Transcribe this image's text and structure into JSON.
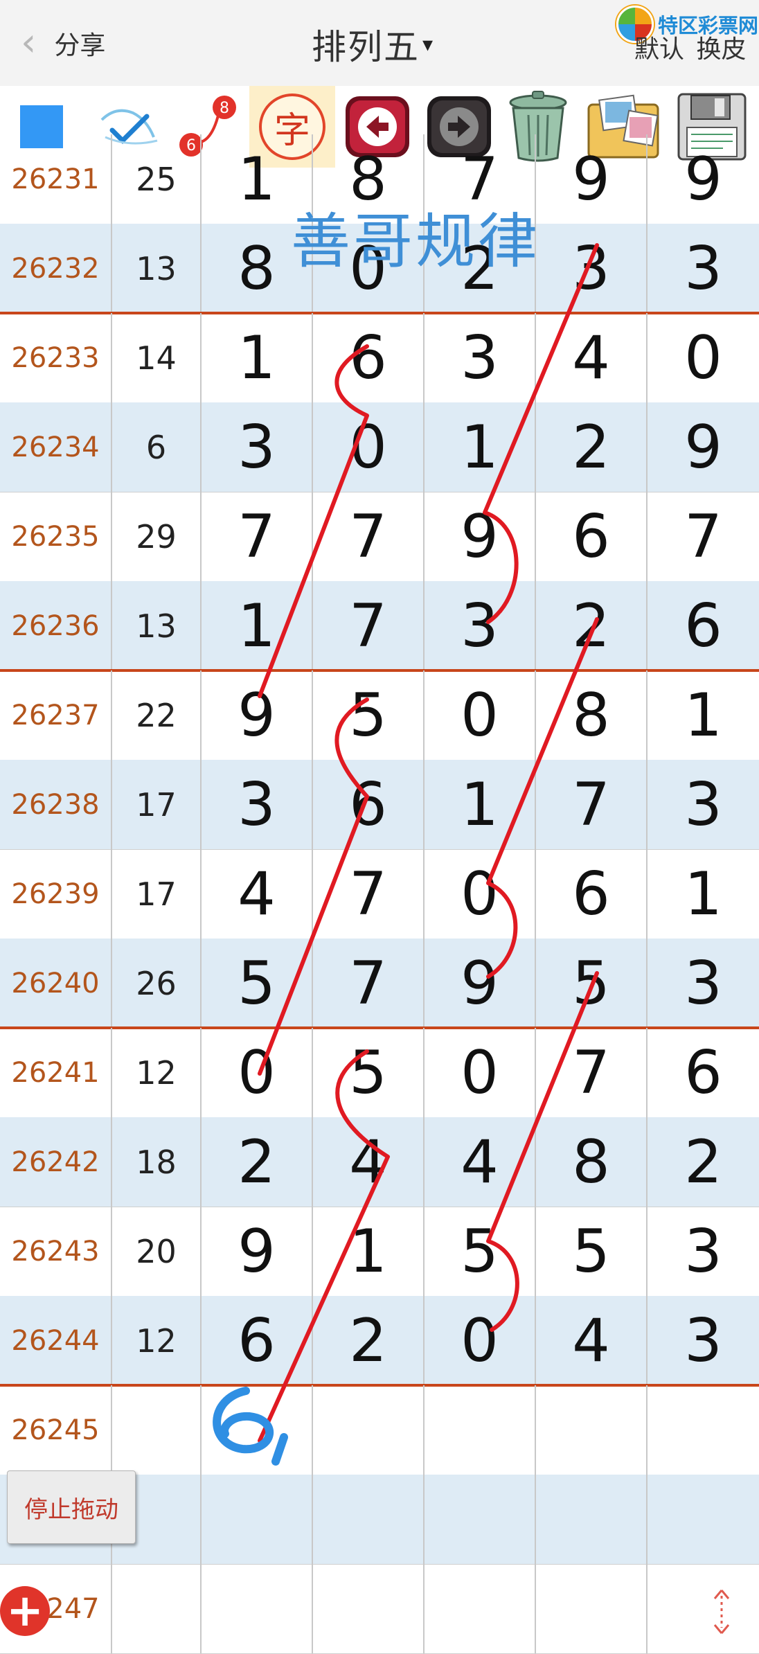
{
  "header": {
    "back_label": "分享",
    "title": "排列五",
    "title_caret": "▾",
    "logo_text": "特区彩票网",
    "default_label": "默认",
    "skin_label": "换皮"
  },
  "toolbar": {
    "icons": [
      "color-square-icon",
      "pen-check-icon",
      "circle-number-icon",
      "text-char-icon",
      "undo-arrow-icon",
      "redo-arrow-icon",
      "trash-can-icon",
      "photo-album-icon",
      "floppy-disk-icon"
    ],
    "circle_badge_top": "8",
    "circle_badge_bottom": "6",
    "text_char": "字",
    "square_color": "#3398f5"
  },
  "overlay": {
    "rule_title": "善哥规律",
    "handwritten_digit": "6",
    "ink_red": "#e01a22",
    "ink_blue": "#2f8fe3"
  },
  "rows": [
    {
      "issue": "26231",
      "sum": "25",
      "d": [
        "1",
        "8",
        "7",
        "9",
        "9"
      ]
    },
    {
      "issue": "26232",
      "sum": "13",
      "d": [
        "8",
        "0",
        "2",
        "3",
        "3"
      ]
    },
    {
      "issue": "26233",
      "sum": "14",
      "d": [
        "1",
        "6",
        "3",
        "4",
        "0"
      ]
    },
    {
      "issue": "26234",
      "sum": "6",
      "d": [
        "3",
        "0",
        "1",
        "2",
        "9"
      ]
    },
    {
      "issue": "26235",
      "sum": "29",
      "d": [
        "7",
        "7",
        "9",
        "6",
        "7"
      ]
    },
    {
      "issue": "26236",
      "sum": "13",
      "d": [
        "1",
        "7",
        "3",
        "2",
        "6"
      ]
    },
    {
      "issue": "26237",
      "sum": "22",
      "d": [
        "9",
        "5",
        "0",
        "8",
        "1"
      ]
    },
    {
      "issue": "26238",
      "sum": "17",
      "d": [
        "3",
        "6",
        "1",
        "7",
        "3"
      ]
    },
    {
      "issue": "26239",
      "sum": "17",
      "d": [
        "4",
        "7",
        "0",
        "6",
        "1"
      ]
    },
    {
      "issue": "26240",
      "sum": "26",
      "d": [
        "5",
        "7",
        "9",
        "5",
        "3"
      ]
    },
    {
      "issue": "26241",
      "sum": "12",
      "d": [
        "0",
        "5",
        "0",
        "7",
        "6"
      ]
    },
    {
      "issue": "26242",
      "sum": "18",
      "d": [
        "2",
        "4",
        "4",
        "8",
        "2"
      ]
    },
    {
      "issue": "26243",
      "sum": "20",
      "d": [
        "9",
        "1",
        "5",
        "5",
        "3"
      ]
    },
    {
      "issue": "26244",
      "sum": "12",
      "d": [
        "6",
        "2",
        "0",
        "4",
        "3"
      ]
    },
    {
      "issue": "26245",
      "sum": "",
      "d": [
        "",
        "",
        "",
        "",
        ""
      ]
    },
    {
      "issue": "",
      "sum": "",
      "d": [
        "",
        "",
        "",
        "",
        ""
      ]
    },
    {
      "issue": "26247",
      "sum": "",
      "d": [
        "",
        "",
        "",
        "",
        ""
      ]
    }
  ],
  "controls": {
    "stop_drag_label": "停止拖动",
    "add_label": "+"
  },
  "colors": {
    "issue_text": "#b3551c",
    "separator": "#c8461b",
    "alt_row": "#deebf5"
  }
}
